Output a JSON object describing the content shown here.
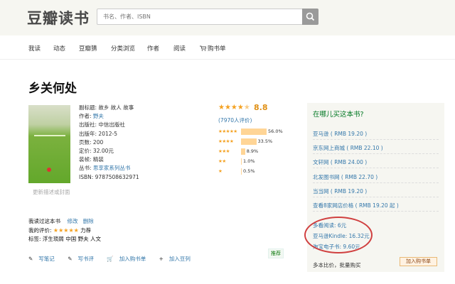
{
  "header": {
    "logo": "豆瓣读书",
    "search_placeholder": "书名、作者、ISBN"
  },
  "nav": {
    "items": [
      "我读",
      "动态",
      "豆瓣猜",
      "分类浏览",
      "作者",
      "阅读",
      "购书单"
    ]
  },
  "book": {
    "title": "乡关何处",
    "cover_caption": "更新描述或封面",
    "info": [
      {
        "label": "副标题:",
        "value": "故乡 故人 故事",
        "link": false
      },
      {
        "label": "作者:",
        "value": "野夫",
        "link": true
      },
      {
        "label": "出版社:",
        "value": "中信出版社",
        "link": false
      },
      {
        "label": "出版年:",
        "value": "2012-5",
        "link": false
      },
      {
        "label": "页数:",
        "value": "200",
        "link": false
      },
      {
        "label": "定价:",
        "value": "32.00元",
        "link": false
      },
      {
        "label": "装帧:",
        "value": "精装",
        "link": false
      },
      {
        "label": "丛书:",
        "value": "思享家系列丛书",
        "link": true
      },
      {
        "label": "ISBN:",
        "value": "9787508632971",
        "link": false
      }
    ]
  },
  "rating": {
    "score": "8.8",
    "count_text": "(7970人评价)",
    "rows": [
      {
        "stars": "★★★★★",
        "percent_text": "56.0%",
        "percent": 56.0
      },
      {
        "stars": "★★★★",
        "percent_text": "33.5%",
        "percent": 33.5
      },
      {
        "stars": "★★★",
        "percent_text": "8.9%",
        "percent": 8.9
      },
      {
        "stars": "★★",
        "percent_text": "1.0%",
        "percent": 1.0
      },
      {
        "stars": "★",
        "percent_text": "0.5%",
        "percent": 0.5
      }
    ]
  },
  "mine": {
    "status": "我读过这本书",
    "edit": "修改",
    "delete": "删除",
    "my_rating_label": "我的评价:",
    "my_rating_text": "力荐",
    "tags": "标签: 浮生琐屑 中国 野夫 人文"
  },
  "actions": {
    "write_note": "写笔记",
    "write_review": "写书评",
    "add_to_cart": "加入购书单",
    "add_to_doulist": "加入豆列",
    "recommend": "推荐"
  },
  "buy": {
    "title": "在哪儿买这本书?",
    "stores": [
      "亚马逊 ( RMB 19.20 )",
      "京东网上商城 ( RMB 22.10 )",
      "文轩网 ( RMB 24.00 )",
      "北发图书网 ( RMB 22.70 )",
      "当当网 ( RMB 19.20 )",
      "查看8家网店价格 ( RMB 19.20 起 )"
    ],
    "ebooks": [
      "多看阅读:   6元",
      "亚马逊Kindle:   16.32元",
      "淘宝电子书:   9.60元"
    ],
    "compare": "多本比价，批量购买",
    "cart_button": "加入购书单"
  }
}
